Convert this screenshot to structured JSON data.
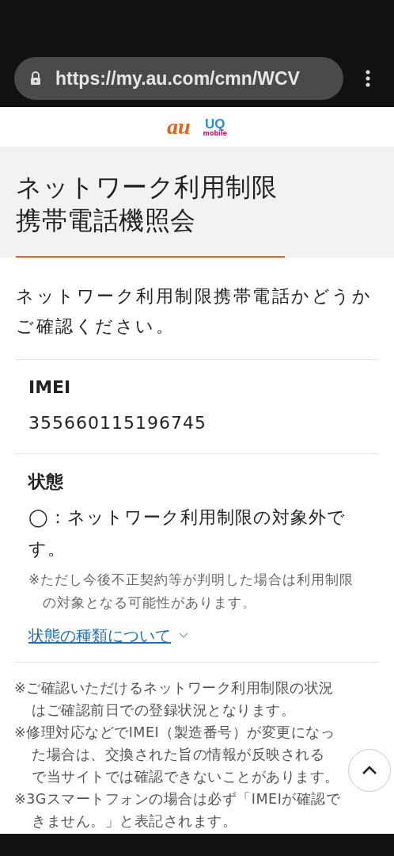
{
  "browser": {
    "url": "https://my.au.com/cmn/WCV"
  },
  "logos": {
    "au": "au",
    "uq": "UQ",
    "uq_sub": "mobile"
  },
  "page_title": "ネットワーク利用制限携帯電話機照会",
  "intro": "ネットワーク利用制限携帯電話かどうかご確認ください。",
  "fields": [
    {
      "label": "IMEI",
      "value": "355660115196745"
    },
    {
      "label": "状態",
      "value": "◯：ネットワーク利用制限の対象外です。",
      "note": "※ただし今後不正契約等が判明した場合は利用制限の対象となる可能性があります。",
      "link": "状態の種類について"
    }
  ],
  "notes": [
    {
      "lines": [
        "※ご確認いただけるネットワーク利用制限の状況",
        "はご確認前日での登録状況となります。"
      ]
    },
    {
      "lines": [
        "※修理対応などでIMEI（製造番号）が変更になっ",
        "た場合は、交換された旨の情報が反映される",
        "で当サイトでは確認できないことがあります。"
      ]
    },
    {
      "lines": [
        "※3Gスマートフォンの場合は必ず「IMEIが確認で",
        "きません。」と表記されます。"
      ]
    }
  ]
}
